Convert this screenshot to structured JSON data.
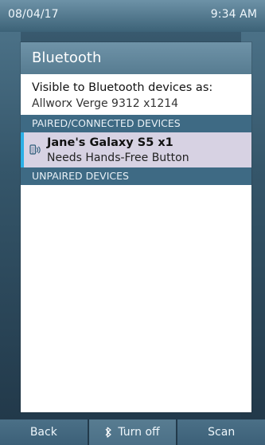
{
  "status": {
    "date": "08/04/17",
    "time": "9:34 AM"
  },
  "screen": {
    "title": "Bluetooth",
    "visible_label": "Visible to Bluetooth devices as:",
    "visible_value": "Allworx Verge 9312 x1214"
  },
  "sections": {
    "paired_header": "PAIRED/CONNECTED DEVICES",
    "unpaired_header": "UNPAIRED DEVICES"
  },
  "device": {
    "name": "Jane's Galaxy S5 x1",
    "status": "Needs Hands-Free Button",
    "icon": "phone-bluetooth-icon"
  },
  "softkeys": {
    "back": "Back",
    "turn_off": "Turn off",
    "scan": "Scan"
  },
  "colors": {
    "accent": "#2cb0e6",
    "header": "#3e6a84",
    "selected_row": "#d7d2e3"
  }
}
